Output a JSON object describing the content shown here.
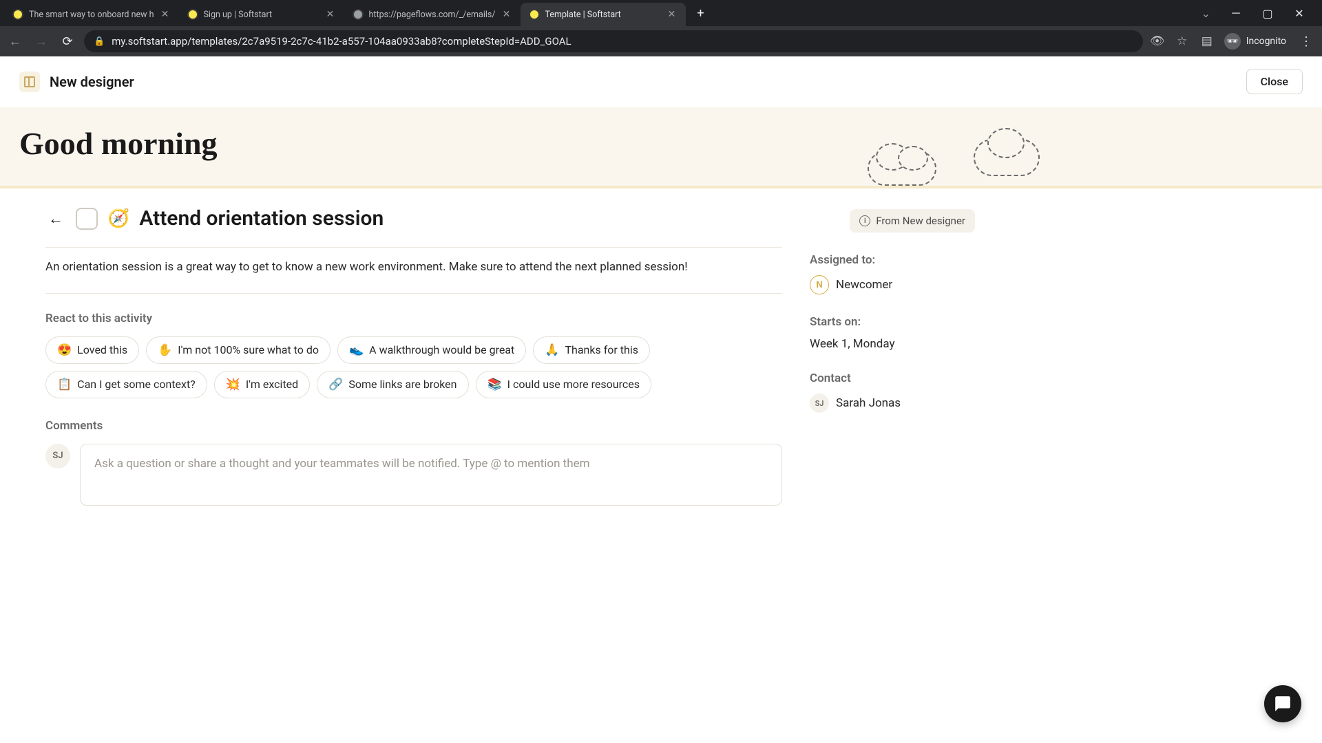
{
  "browser": {
    "tabs": [
      {
        "title": "The smart way to onboard new h",
        "faviconType": "yellow"
      },
      {
        "title": "Sign up | Softstart",
        "faviconType": "yellow"
      },
      {
        "title": "https://pageflows.com/_/emails/",
        "faviconType": "globe"
      },
      {
        "title": "Template | Softstart",
        "faviconType": "yellow",
        "active": true
      }
    ],
    "url": "my.softstart.app/templates/2c7a9519-2c7c-41b2-a557-104aa0933ab8?completeStepId=ADD_GOAL",
    "incognitoLabel": "Incognito"
  },
  "header": {
    "breadcrumb": "New designer",
    "close": "Close"
  },
  "hero": {
    "greeting": "Good morning"
  },
  "task": {
    "emoji": "🧭",
    "title": "Attend orientation session",
    "fromLabel": "From New designer",
    "description": "An orientation session is a great way to get to know a new work environment. Make sure to attend the next planned session!"
  },
  "reactions": {
    "label": "React to this activity",
    "items": [
      {
        "emoji": "😍",
        "text": "Loved this"
      },
      {
        "emoji": "✋",
        "text": "I'm not 100% sure what to do"
      },
      {
        "emoji": "👟",
        "text": "A walkthrough would be great"
      },
      {
        "emoji": "🙏",
        "text": "Thanks for this"
      },
      {
        "emoji": "📋",
        "text": "Can I get some context?"
      },
      {
        "emoji": "💥",
        "text": "I'm excited"
      },
      {
        "emoji": "🔗",
        "text": "Some links are broken"
      },
      {
        "emoji": "📚",
        "text": "I could use more resources"
      }
    ]
  },
  "comments": {
    "label": "Comments",
    "avatarInitials": "SJ",
    "placeholder": "Ask a question or share a thought and your teammates will be notified. Type @ to mention them"
  },
  "sidebar": {
    "assignedLabel": "Assigned to:",
    "assignee": {
      "initial": "N",
      "name": "Newcomer"
    },
    "startsLabel": "Starts on:",
    "startsValue": "Week 1, Monday",
    "contactLabel": "Contact",
    "contact": {
      "initials": "SJ",
      "name": "Sarah Jonas"
    }
  }
}
